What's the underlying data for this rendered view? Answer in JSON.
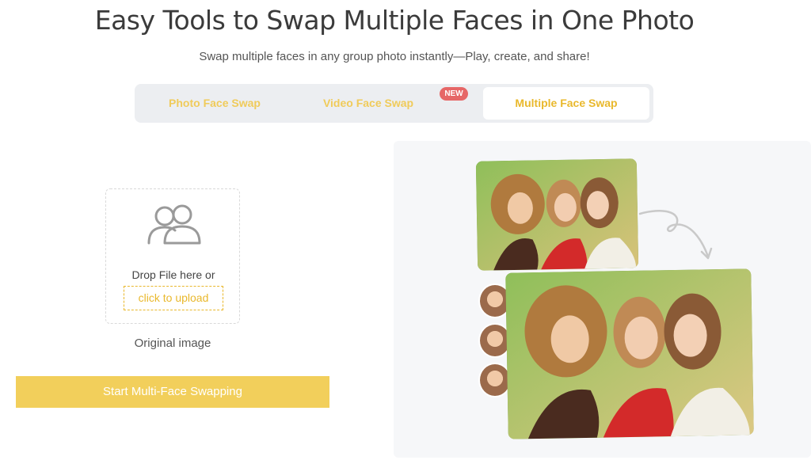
{
  "header": {
    "title": "Easy Tools to Swap Multiple Faces in One Photo",
    "subtitle": "Swap multiple faces in any group photo instantly—Play, create, and share!"
  },
  "tabs": [
    {
      "label": "Photo Face Swap"
    },
    {
      "label": "Video Face Swap"
    },
    {
      "label": "Multiple Face Swap"
    }
  ],
  "badge": "NEW",
  "upload": {
    "icon": "people-icon",
    "drop_text": "Drop File here or",
    "link_text": "click to upload",
    "caption": "Original image"
  },
  "action": {
    "start_label": "Start Multi-Face Swapping"
  },
  "colors": {
    "accent": "#f2cf5b",
    "accent_text": "#e9b82c",
    "badge": "#e66767"
  }
}
